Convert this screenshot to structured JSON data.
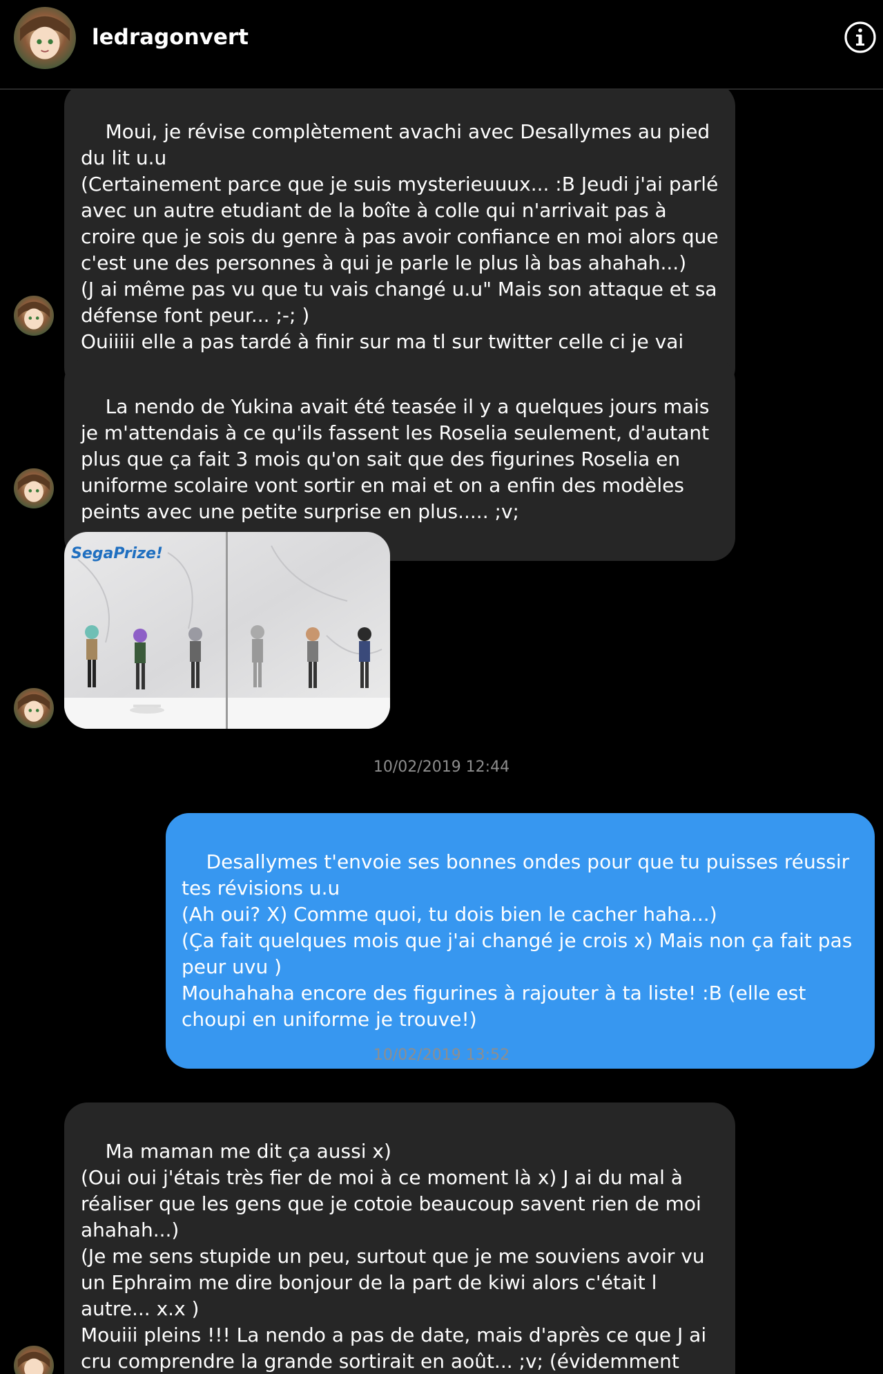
{
  "header": {
    "username": "ledragonvert",
    "avatar_icon": "profile-avatar",
    "info_icon": "info-icon"
  },
  "messages": [
    {
      "from": "them",
      "text": "Moui, je révise complètement avachi avec Desallymes au pied du lit u.u\n(Certainement parce que je suis mysterieuuux... :B Jeudi j'ai parlé avec un autre etudiant de la boîte à colle qui n'arrivait pas à croire que je sois du genre à pas avoir confiance en moi alors que c'est une des personnes à qui je parle le plus là bas ahahah...)\n(J ai même pas vu que tu vais changé u.u\" Mais son attaque et sa défense font peur... ;-; )\nOuiiiii elle a pas tardé à finir sur ma tl sur twitter celle ci je vai"
    },
    {
      "from": "them",
      "text": "La nendo de Yukina avait été teasée il y a quelques jours mais je m'attendais à ce qu'ils fassent les Roselia seulement, d'autant plus que ça fait 3 mois qu'on sait que des figurines Roselia en uniforme scolaire vont sortir en mai et on a enfin des modèles peints avec une petite surprise en plus..... ;v;"
    },
    {
      "from": "them",
      "type": "image",
      "image_caption": "SegaPrize!"
    },
    {
      "timestamp": "10/02/2019 12:44"
    },
    {
      "from": "me",
      "text": "Desallymes t'envoie ses bonnes ondes pour que tu puisses réussir tes révisions u.u\n(Ah oui? X) Comme quoi, tu dois bien le cacher haha...)\n(Ça fait quelques mois que j'ai changé je crois x) Mais non ça fait pas peur uvu )\nMouhahaha encore des figurines à rajouter à ta liste! :B (elle est choupi en uniforme je trouve!)"
    },
    {
      "timestamp": "10/02/2019 13:52"
    },
    {
      "from": "them",
      "text": "Ma maman me dit ça aussi x)\n(Oui oui j'étais très fier de moi à ce moment là x) J ai du mal à réaliser que les gens que je cotoie beaucoup savent rien de moi ahahah...)\n(Je me sens stupide un peu, surtout que je me souviens avoir vu un Ephraim me dire bonjour de la part de kiwi alors c'était l autre... x.x )\nMouiii pleins !!! La nendo a pas de date, mais d'après ce que J ai cru comprendre la grande sortirait en août... ;v; (évidemment qu'elle est choupi blblblbl ;v; )"
    }
  ],
  "colors": {
    "incoming_bubble": "#262626",
    "outgoing_bubble": "#3797f0",
    "background": "#000000",
    "timestamp": "#8e8e8e"
  }
}
